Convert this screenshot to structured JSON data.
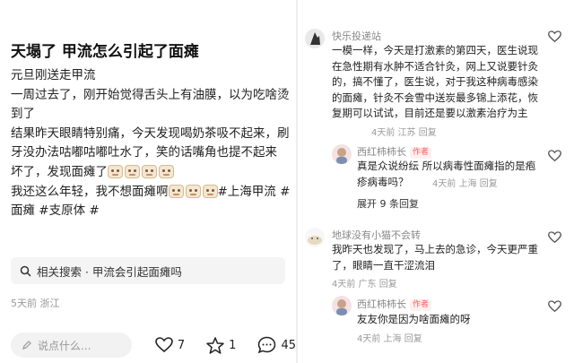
{
  "post": {
    "title": "天塌了 甲流怎么引起了面瘫",
    "lines": [
      "元旦刚送走甲流",
      "一周过去了，刚开始觉得舌头上有油膜，以为吃啥烫到了",
      "结果昨天眼睛特别痛，今天发现喝奶茶吸不起来，刷牙没办法咕嘟咕嘟吐水了，笑的话嘴角也提不起来",
      "坏了，发现面瘫了",
      "我还这么年轻，我不想面瘫啊",
      "#上海甲流 #面瘫 #支原体 #"
    ],
    "related_search": "相关搜索 · 甲流会引起面瘫吗",
    "meta": "5天前 浙江",
    "comment_placeholder": "说点什么...",
    "likes": "7",
    "favorites": "1",
    "comments": "45"
  },
  "comments": [
    {
      "name": "快乐投递站",
      "text": "一模一样，今天是打激素的第四天，医生说现在急性期有水肿不适合针灸，网上又说要针灸的，搞不懂了，医生说，对于我这种病毒感染的面瘫，针灸不会雪中送炭最多锦上添花，恢复期可以试试，目前还是要以激素治疗为主",
      "time": "4天前 江苏 回复"
    },
    {
      "name": "西红柿柿长",
      "tag": "作者",
      "text": "真是众说纷纭 所以病毒性面瘫指的是疱疹病毒吗？",
      "time": "4天前 上海 回复"
    },
    {
      "expand": "展开 9 条回复"
    },
    {
      "name": "地球没有小猫不会转",
      "text": "我昨天也发现了，马上去的急诊，今天更严重了，眼睛一直干涩流泪",
      "time": "4天前 广东 回复"
    },
    {
      "name": "西红柿柿长",
      "tag": "作者",
      "text": "友友你是因为啥面瘫的呀",
      "time": "4天前 上海 回复"
    }
  ]
}
